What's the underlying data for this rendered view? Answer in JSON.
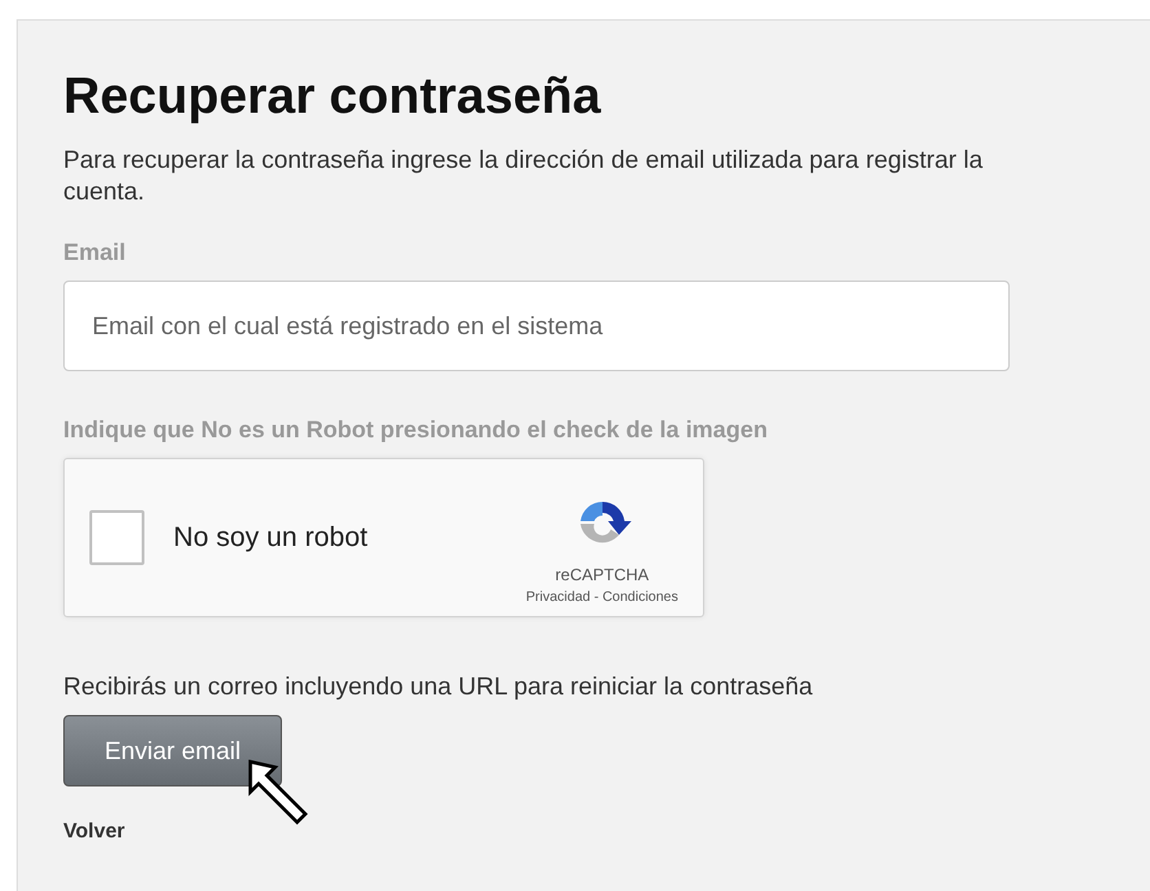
{
  "title": "Recuperar contraseña",
  "intro": "Para recuperar la contraseña ingrese la dirección de email utilizada para registrar la cuenta.",
  "email": {
    "label": "Email",
    "placeholder": "Email con el cual está registrado en el sistema"
  },
  "captcha": {
    "label": "Indique que No es un Robot presionando el check de la imagen",
    "checkbox_label": "No soy un robot",
    "checked": false,
    "brand": "reCAPTCHA",
    "links": "Privacidad - Condiciones"
  },
  "note": "Recibirás un correo incluyendo una URL para reiniciar la contraseña",
  "submit": "Enviar email",
  "back": "Volver"
}
